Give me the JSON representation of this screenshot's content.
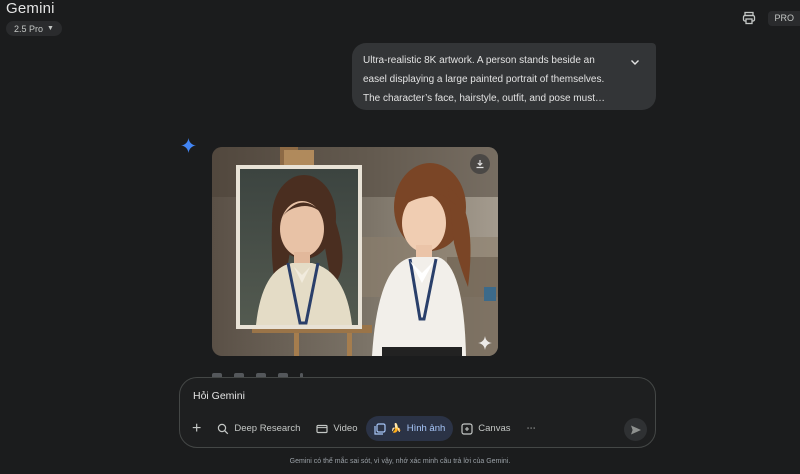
{
  "app": {
    "title": "Gemini",
    "model": "2.5 Pro",
    "plan_badge": "PRO"
  },
  "conversation": {
    "user_message": {
      "lines": [
        "Ultra-realistic 8K artwork. A person stands beside an",
        "easel displaying a large painted portrait of themselves.",
        "The character’s face, hairstyle, outfit, and pose must…"
      ],
      "expand_icon": "chevron-down-icon"
    },
    "response": {
      "avatar_icon": "gemini-sparkle-icon",
      "image_actions": {
        "download_icon": "download-icon",
        "badge_icon": "sparkle-icon"
      },
      "feedback_icons": [
        "thumb-up-icon",
        "thumb-down-icon",
        "share-icon",
        "copy-icon",
        "more-icon"
      ]
    }
  },
  "composer": {
    "placeholder": "Hỏi Gemini",
    "tools": [
      {
        "label": "Deep Research",
        "icon": "deep-research-icon"
      },
      {
        "label": "Video",
        "icon": "video-icon"
      },
      {
        "label": "Hình ảnh",
        "icon": "image-icon",
        "emoji": "🍌",
        "active": true
      },
      {
        "label": "Canvas",
        "icon": "canvas-icon"
      }
    ],
    "more_label": "⋯",
    "plus_label": "+"
  },
  "footer": {
    "disclaimer": "Gemini có thể mắc sai sót, vì vậy, nhớ xác minh câu trả lời của Gemini."
  },
  "colors": {
    "accent": "#a8c7fa",
    "background": "#1b1c1d",
    "bubble": "#333537",
    "sparkle": "#4285f4"
  }
}
